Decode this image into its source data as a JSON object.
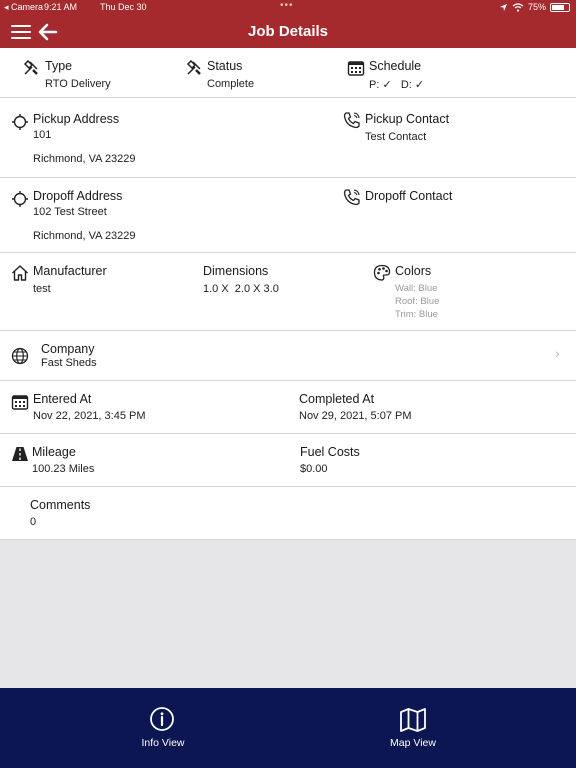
{
  "status_bar": {
    "left": "◂ Camera",
    "time": "9:21 AM",
    "date": "Thu Dec 30",
    "dots": "•••",
    "battery": "75%",
    "battery_level": 0.75
  },
  "header": {
    "title": "Job Details",
    "icons": [
      "menu-icon",
      "back-arrow-icon"
    ]
  },
  "type": {
    "label": "Type",
    "value": "RTO Delivery",
    "icon": "tools-icon"
  },
  "status": {
    "label": "Status",
    "value": "Complete",
    "icon": "tools-icon"
  },
  "schedule": {
    "label": "Schedule",
    "value": "P: ✓   D: ✓",
    "icon": "calendar-icon"
  },
  "pickup_address": {
    "label": "Pickup Address",
    "line1": "101",
    "line2": "Richmond, VA 23229",
    "icon": "crosshair-icon"
  },
  "pickup_contact": {
    "label": "Pickup Contact",
    "value": "Test Contact",
    "icon": "phone-icon"
  },
  "dropoff_address": {
    "label": "Dropoff Address",
    "line1": "102 Test Street",
    "line2": "Richmond, VA 23229",
    "icon": "crosshair-icon"
  },
  "dropoff_contact": {
    "label": "Dropoff Contact",
    "icon": "phone-icon"
  },
  "manufacturer": {
    "label": "Manufacturer",
    "value": "test",
    "icon": "home-icon"
  },
  "dimensions": {
    "label": "Dimensions",
    "value": "1.0 X  2.0 X 3.0"
  },
  "colors": {
    "label": "Colors",
    "wall": "Wall: Blue",
    "roof": "Roof: Blue",
    "trim": "Trim: Blue",
    "icon": "palette-icon"
  },
  "company": {
    "label": "Company",
    "value": "Fast Sheds",
    "chevron": "›",
    "icon": "globe-icon"
  },
  "entered_at": {
    "label": "Entered At",
    "value": "Nov 22, 2021, 3:45 PM",
    "icon": "calendar-icon"
  },
  "completed_at": {
    "label": "Completed At",
    "value": "Nov 29, 2021, 5:07 PM"
  },
  "mileage": {
    "label": "Mileage",
    "value": "100.23 Miles",
    "icon": "road-icon"
  },
  "fuel_costs": {
    "label": "Fuel Costs",
    "value": "$0.00"
  },
  "comments": {
    "label": "Comments",
    "value": "0"
  },
  "tabs": [
    {
      "label": "Info View",
      "icon": "info-circle-icon"
    },
    {
      "label": "Map View",
      "icon": "map-icon"
    }
  ],
  "colors_theme": {
    "header": "#a52a2e",
    "tabbar": "#0b1653",
    "background": "#e6e6e8"
  }
}
